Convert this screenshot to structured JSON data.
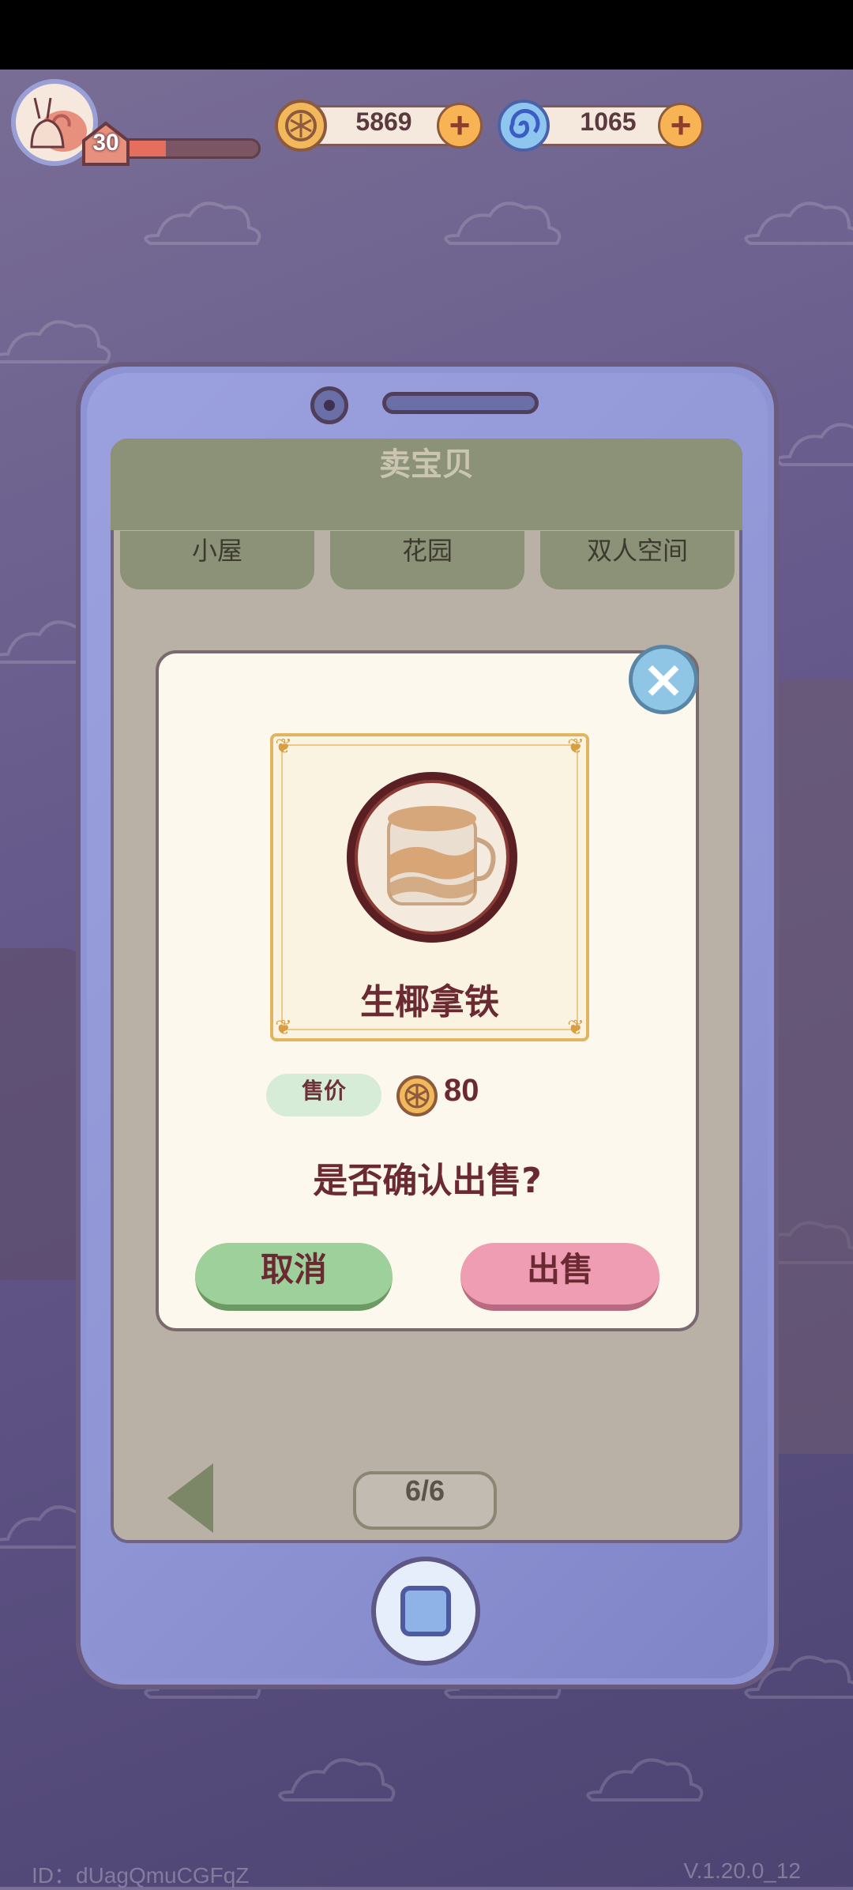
{
  "hud": {
    "level": "30",
    "coins": "5869",
    "gems": "1065",
    "level_progress": 0.33
  },
  "sell_screen": {
    "title": "卖宝贝",
    "tabs": [
      "小屋",
      "花园",
      "双人空间"
    ],
    "pager": "6/6"
  },
  "dialog": {
    "item_name": "生椰拿铁",
    "price_label": "售价",
    "price_value": "80",
    "question": "是否确认出售?",
    "cancel_label": "取消",
    "sell_label": "出售"
  },
  "footer": {
    "id_text": "ID：dUagQmuCGFqZ",
    "version": "V.1.20.0_12"
  },
  "colors": {
    "coin": "#f2b85c",
    "gem": "#5b8ee6",
    "cancel": "#9dd09a",
    "sell": "#ee9db3"
  }
}
